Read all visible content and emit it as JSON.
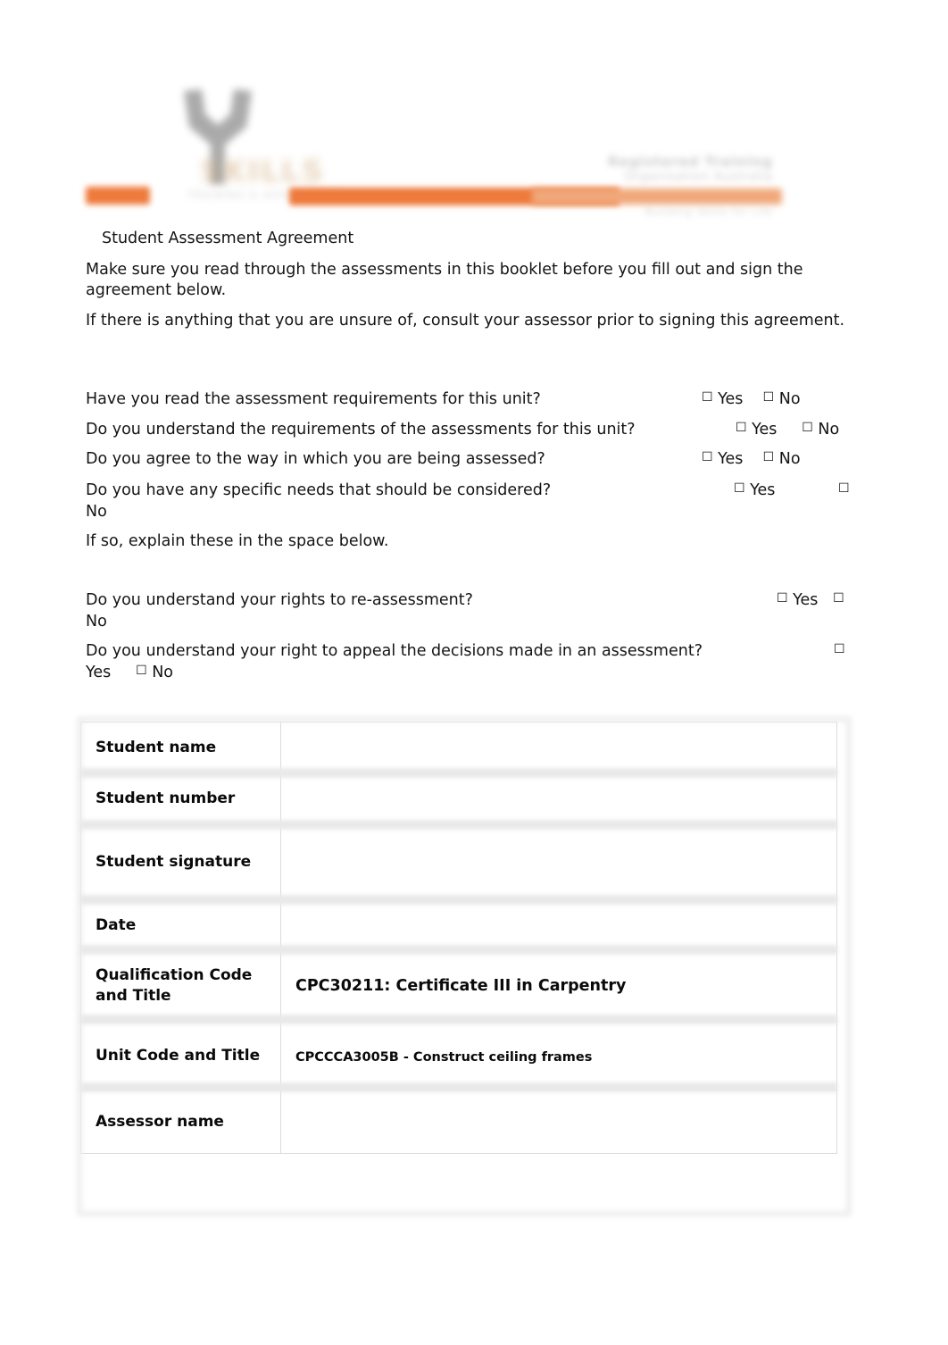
{
  "header": {
    "logo_wordmark": "SKILLS",
    "logo_tagline": "TRAINING & ASSESSMENT",
    "right_line_1": "Registered Training",
    "right_line_2": "Organisation Australia",
    "right_line_3": "Building Skills for Life"
  },
  "document": {
    "title": "Student Assessment Agreement",
    "intro_paragraph_1": "Make sure you read through the assessments in this booklet before you fill out and sign the agreement below.",
    "intro_paragraph_2": "If there is anything that you are unsure of, consult your assessor prior to signing this agreement.",
    "explain_note": "If so, explain these in the space below."
  },
  "questions": [
    {
      "text": "Have you read the assessment requirements for this unit?",
      "yes_label": "Yes",
      "no_label": "No",
      "checkbox": "☐"
    },
    {
      "text": "Do you understand the requirements of the assessments for this unit?",
      "yes_label": "Yes",
      "no_label": "No",
      "checkbox": "☐"
    },
    {
      "text": "Do you agree to the way in which you are being assessed?",
      "yes_label": "Yes",
      "no_label": "No",
      "checkbox": "☐"
    },
    {
      "text": "Do you have any specific needs that should be considered?",
      "yes_label": "Yes",
      "no_label": "No",
      "checkbox": "☐"
    },
    {
      "text": "Do you understand your rights to re-assessment?",
      "yes_label": "Yes",
      "no_label": "No",
      "checkbox": "☐"
    },
    {
      "text": "Do you understand your right to appeal the decisions made in an assessment?",
      "yes_label": "Yes",
      "no_label": "No",
      "checkbox": "☐"
    }
  ],
  "table": {
    "rows": [
      {
        "label": "Student name",
        "value": ""
      },
      {
        "label": "Student number",
        "value": ""
      },
      {
        "label": "Student signature",
        "value": ""
      },
      {
        "label": "Date",
        "value": ""
      },
      {
        "label": "Qualification Code and Title",
        "value": "CPC30211: Certificate III in Carpentry"
      },
      {
        "label": "Unit Code and Title",
        "value": "CPCCCA3005B - Construct ceiling frames"
      },
      {
        "label": "Assessor name",
        "value": ""
      }
    ]
  },
  "colors": {
    "accent_orange": "#ee7a3c",
    "accent_orange_light": "#f0a87a",
    "logo_gray": "#8a8a8a",
    "text": "#141414",
    "table_border": "#dcdcdc",
    "table_band": "#e9e9e9"
  }
}
